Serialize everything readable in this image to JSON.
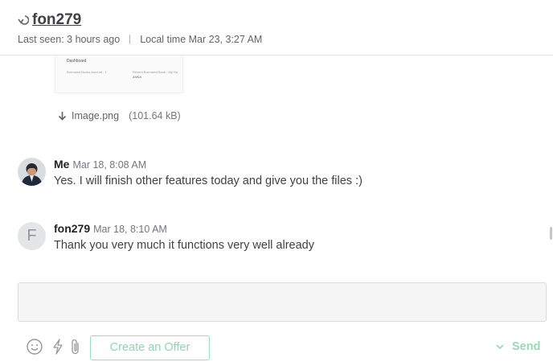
{
  "header": {
    "username": "fon279",
    "last_seen": "Last seen: 3 hours ago",
    "local_time": "Local time Mar 23, 3:27 AM"
  },
  "attachment": {
    "preview": {
      "title": "Dashboard",
      "left_label": "Borrowed Books Amount : 1",
      "right_label": "Recent Borrowed Book : My Na",
      "right_value": "ANNA"
    },
    "filename": "Image.png",
    "size": "(101.64 kB)"
  },
  "messages": [
    {
      "sender": "Me",
      "time": "Mar 18, 8:08 AM",
      "text": "Yes. I will finish other features today and give you the files :)",
      "avatar": "photo"
    },
    {
      "sender": "fon279",
      "time": "Mar 18, 8:10 AM",
      "text": "Thank you very much it functions very well already",
      "avatar_letter": "F"
    }
  ],
  "composer": {
    "placeholder": "",
    "create_offer_label": "Create an Offer",
    "send_label": "Send"
  },
  "colors": {
    "accent_light": "#9ad9b7",
    "text": "#404145",
    "muted": "#74767e"
  },
  "icons": [
    "back-arrow-icon",
    "download-icon",
    "emoji-icon",
    "lightning-icon",
    "paperclip-icon",
    "chevron-down-icon"
  ]
}
